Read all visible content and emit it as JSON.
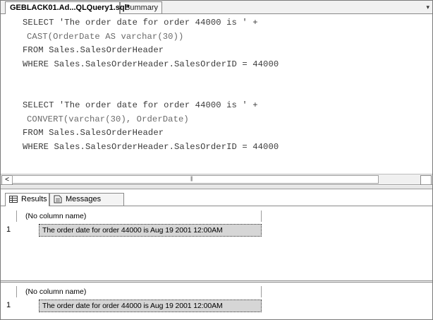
{
  "tabs": [
    {
      "label": "GEBLACK01.Ad...QLQuery1.sql*",
      "active": true
    },
    {
      "label": "Summary",
      "active": false
    }
  ],
  "editor": {
    "lines": [
      "SELECT 'The order date for order 44000 is ' +",
      "CAST(OrderDate AS varchar(30))",
      "FROM Sales.SalesOrderHeader",
      "WHERE Sales.SalesOrderHeader.SalesOrderID = 44000",
      "SELECT 'The order date for order 44000 is ' +",
      "CONVERT(varchar(30), OrderDate)",
      "FROM Sales.SalesOrderHeader",
      "WHERE Sales.SalesOrderHeader.SalesOrderID = 44000"
    ]
  },
  "results_tabs": [
    "Results",
    "Messages"
  ],
  "grids": [
    {
      "column": "(No column name)",
      "row_num": "1",
      "value": "The order date for order 44000 is Aug 19 2001 12:00AM"
    },
    {
      "column": "(No column name)",
      "row_num": "1",
      "value": "The order date for order 44000 is Aug 19 2001 12:00AM"
    }
  ],
  "colors": {
    "keyword": "#3a3a3a",
    "function": "#6a6a6a",
    "selected_cell": "#d6d6d6"
  }
}
